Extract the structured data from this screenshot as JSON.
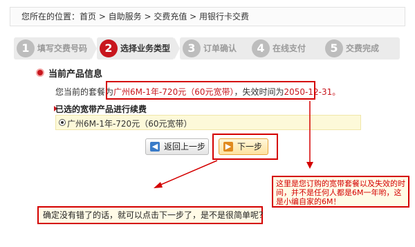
{
  "breadcrumb": "您所在的位置：首页 > 自助服务 > 交费充值 > 用银行卡交费",
  "steps": [
    {
      "num": "1",
      "label": "填写交费号码",
      "active": false
    },
    {
      "num": "2",
      "label": "选择业务类型",
      "active": true
    },
    {
      "num": "3",
      "label": "订单确认",
      "active": false
    },
    {
      "num": "4",
      "label": "在线支付",
      "active": false
    },
    {
      "num": "5",
      "label": "交费完成",
      "active": false
    }
  ],
  "product": {
    "section_title": "当前产品信息",
    "prefix": "您当前的套餐为",
    "package": "广州6M-1年-720元（60元宽带）",
    "mid": "，失效时间为",
    "expiry": "2050-12-31",
    "suffix": "。"
  },
  "renew": {
    "title": "已选的宽带产品进行续费",
    "option": "广州6M-1年-720元（60元宽带）"
  },
  "buttons": {
    "back": "返回上一步",
    "next": "下一步"
  },
  "annotations": {
    "left": "确定没有错了的话，就可以点击下一步了，是不是很简单呢？",
    "right": "这里是您订购的宽带套餐以及失效的时间，并不是任何人都是6M一年哟，这是小编自家的6M！"
  },
  "colors": {
    "accent": "#c8161d",
    "annotation": "#d40000"
  }
}
